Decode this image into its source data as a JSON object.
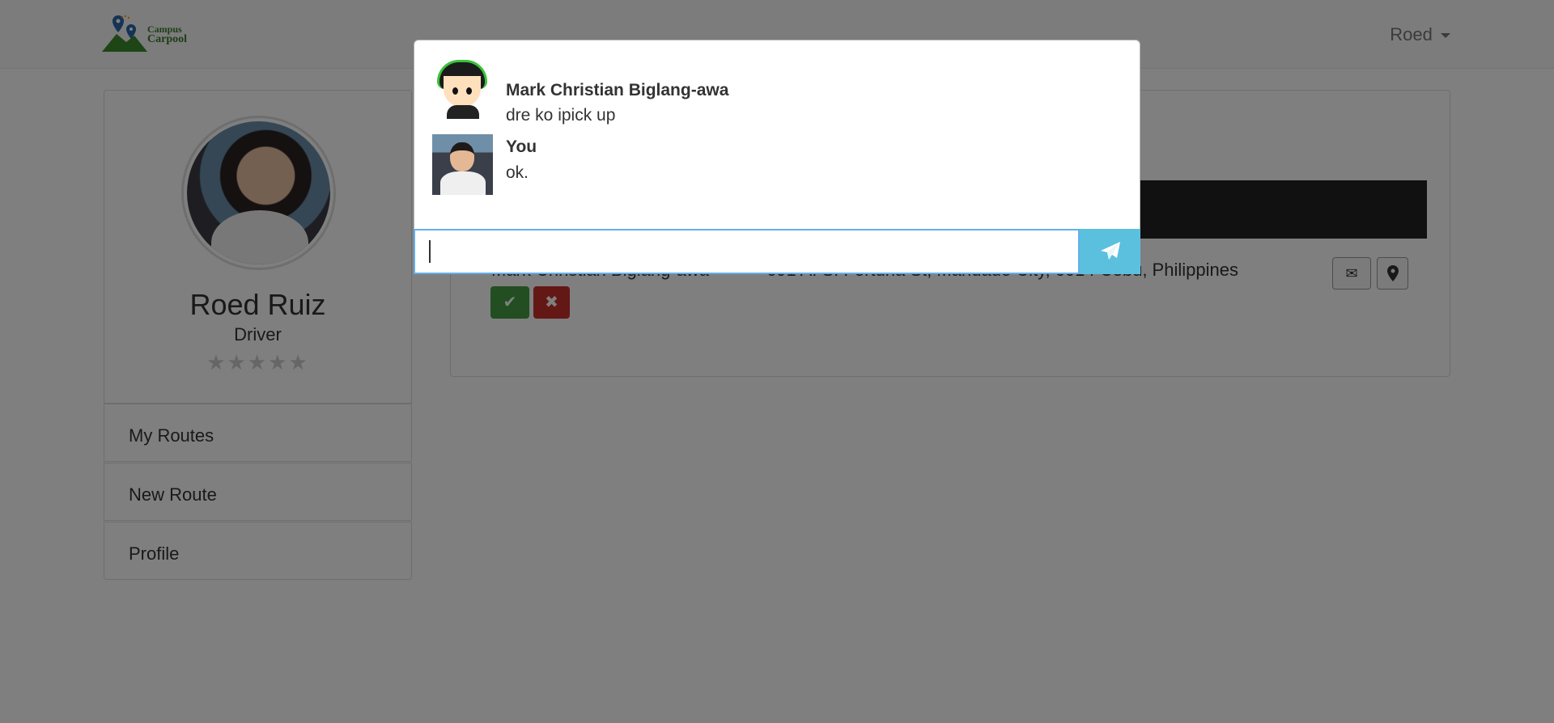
{
  "navbar": {
    "logo_line1": "Campus",
    "logo_line2": "Carpool",
    "user_name": "Roed"
  },
  "sidebar": {
    "name": "Roed Ruiz",
    "role": "Driver",
    "rating_stars": "★★★★★",
    "rating_value": 0,
    "items": [
      {
        "label": "My Routes"
      },
      {
        "label": "New Route"
      },
      {
        "label": "Profile"
      }
    ]
  },
  "main": {
    "request": {
      "passenger": "Mark Christian Biglang-awa",
      "address": "691 A. S. Fortuna St, Mandaue City, 6014 Cebu, Philippines",
      "accept_icon": "check-icon",
      "reject_icon": "times-icon",
      "message_icon": "envelope-icon",
      "map_icon": "map-marker-icon"
    }
  },
  "chat": {
    "messages": [
      {
        "sender": "Mark Christian Biglang-awa",
        "text": "dre ko ipick up"
      },
      {
        "sender": "You",
        "text": "ok."
      }
    ],
    "input_value": "",
    "send_icon": "paper-plane-icon"
  },
  "colors": {
    "accept": "#449d44",
    "reject": "#c9302c",
    "send": "#5bc0de",
    "input_focus": "#66afe9",
    "dark_bar": "#222222"
  }
}
